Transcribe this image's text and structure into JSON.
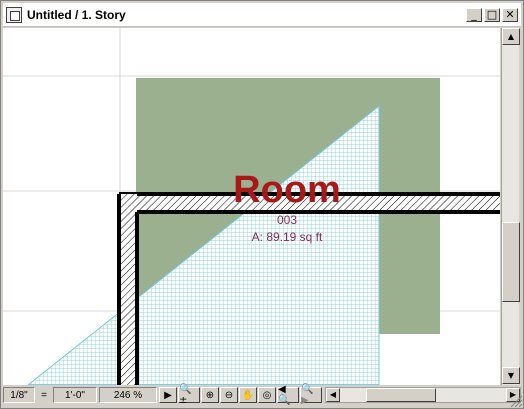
{
  "window": {
    "title": "Untitled / 1. Story",
    "minimize_glyph": "_",
    "maximize_glyph": "□",
    "close_glyph": "✕"
  },
  "drawing": {
    "room_name": "Room",
    "room_number": "003",
    "room_area": "A: 89.19 sq ft",
    "colors": {
      "zone_fill": "#9bb08f",
      "hatch_line": "#6ec8e0",
      "room_name": "#a81818",
      "room_info": "#8b2a52",
      "wall": "#000000",
      "grid": "#d8d8d8"
    }
  },
  "statusbar": {
    "scale_left": "1/8\"",
    "scale_eq": "=",
    "scale_right": "1'-0\"",
    "zoom": "246 %",
    "icons": [
      {
        "name": "play-icon",
        "glyph": "▶",
        "enabled": true
      },
      {
        "name": "zoom-options-icon",
        "glyph": "🔍±",
        "enabled": true
      },
      {
        "name": "zoom-in-icon",
        "glyph": "⊕",
        "enabled": true
      },
      {
        "name": "zoom-out-icon",
        "glyph": "⊖",
        "enabled": true
      },
      {
        "name": "pan-hand-icon",
        "glyph": "✋",
        "enabled": true
      },
      {
        "name": "fit-window-icon",
        "glyph": "◎",
        "enabled": true
      },
      {
        "name": "previous-view-icon",
        "glyph": "◀🔍",
        "enabled": true
      },
      {
        "name": "next-view-icon",
        "glyph": "🔍▶",
        "enabled": false
      }
    ]
  },
  "scrollbars": {
    "up_arrow": "▲",
    "down_arrow": "▼",
    "left_arrow": "◀",
    "right_arrow": "▶"
  }
}
